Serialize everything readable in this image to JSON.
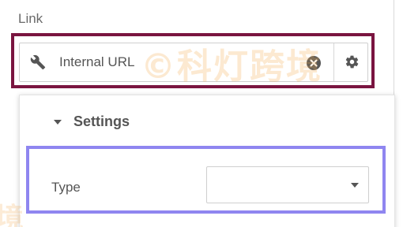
{
  "link": {
    "label": "Link",
    "value": "Internal URL"
  },
  "settings": {
    "title": "Settings",
    "type_label": "Type",
    "type_value": ""
  },
  "icons": {
    "field_icon": "wrench-icon",
    "clear_icon": "clear-circle-icon",
    "settings_icon": "gear-icon"
  },
  "colors": {
    "highlight_link": "#7a1540",
    "highlight_type": "#8f86f0"
  },
  "watermark": {
    "text": "©科灯跨境",
    "corner": "境"
  }
}
